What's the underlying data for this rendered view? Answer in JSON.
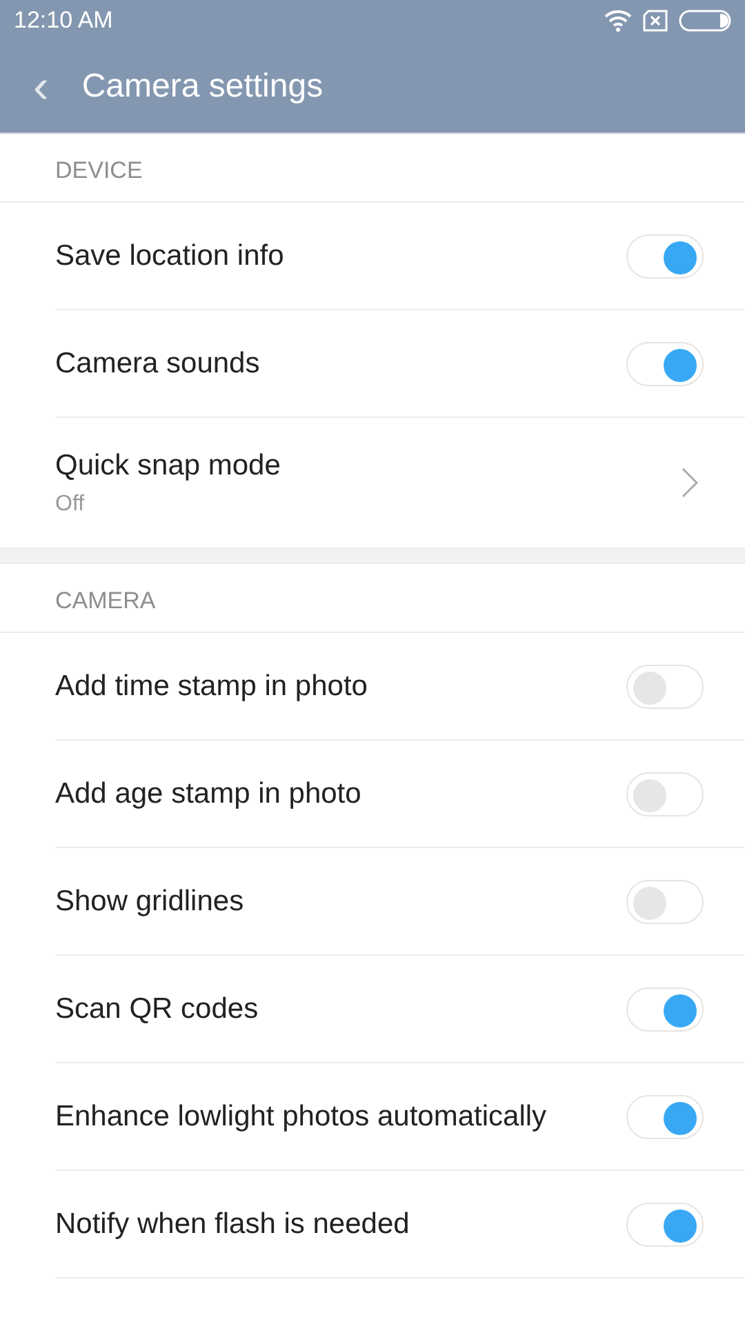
{
  "status_bar": {
    "time": "12:10  AM"
  },
  "header": {
    "back": "‹",
    "title": "Camera  settings"
  },
  "sections": [
    {
      "title": "DEVICE",
      "items": [
        {
          "kind": "toggle",
          "label": "Save location info",
          "on": true
        },
        {
          "kind": "toggle",
          "label": "Camera sounds",
          "on": true
        },
        {
          "kind": "link",
          "label": "Quick snap mode",
          "value": "Off"
        }
      ]
    },
    {
      "title": "CAMERA",
      "items": [
        {
          "kind": "toggle",
          "label": "Add time stamp in photo",
          "on": false
        },
        {
          "kind": "toggle",
          "label": "Add age stamp in photo",
          "on": false
        },
        {
          "kind": "toggle",
          "label": "Show gridlines",
          "on": false
        },
        {
          "kind": "toggle",
          "label": "Scan QR codes",
          "on": true
        },
        {
          "kind": "toggle",
          "label": "Enhance lowlight photos automatically",
          "on": true
        },
        {
          "kind": "toggle",
          "label": "Notify when flash is needed",
          "on": true
        }
      ]
    }
  ]
}
